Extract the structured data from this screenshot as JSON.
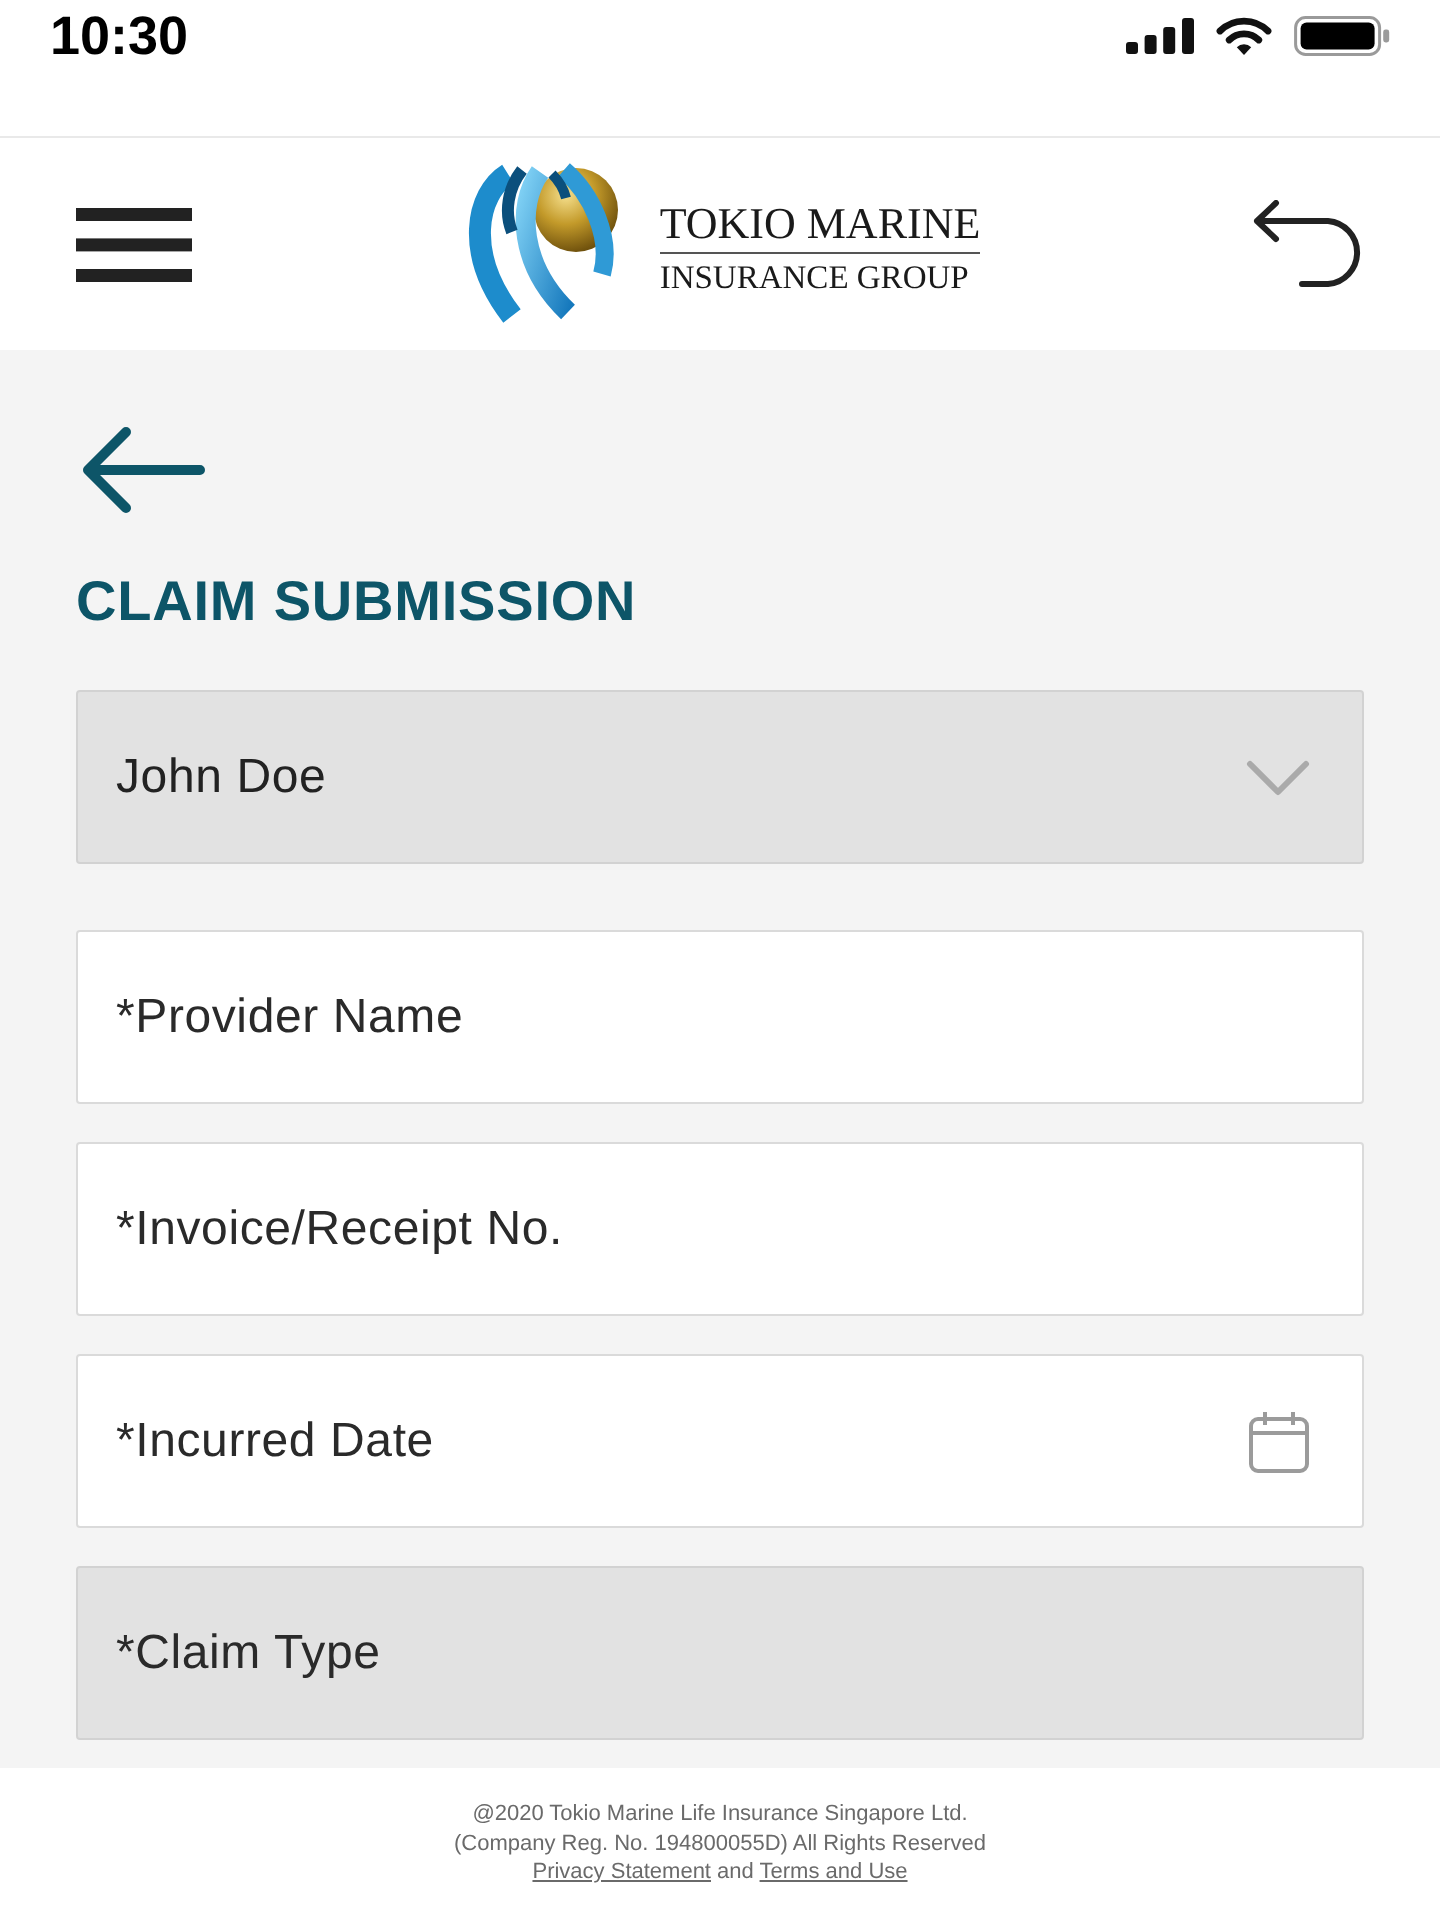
{
  "status_bar": {
    "time": "10:30"
  },
  "header": {
    "logo": {
      "name": "TOKIO MARINE",
      "tagline": "INSURANCE GROUP"
    }
  },
  "page": {
    "title": "CLAIM SUBMISSION"
  },
  "fields": [
    {
      "kind": "select",
      "value": "John Doe",
      "disabled": true
    },
    {
      "kind": "text",
      "placeholder": "*Provider Name",
      "disabled": false
    },
    {
      "kind": "text",
      "placeholder": "*Invoice/Receipt No.",
      "disabled": false
    },
    {
      "kind": "date",
      "placeholder": "*Incurred Date",
      "disabled": false
    },
    {
      "kind": "text",
      "placeholder": "*Claim Type",
      "disabled": true
    }
  ],
  "footer": {
    "copyright": "@2020 Tokio Marine Life Insurance Singapore Ltd.",
    "registration": "(Company Reg. No. 194800055D) All Rights Reserved",
    "links": [
      {
        "label": "Privacy Statement"
      },
      {
        "label": "Terms and Use"
      }
    ],
    "conjunction": "and"
  }
}
